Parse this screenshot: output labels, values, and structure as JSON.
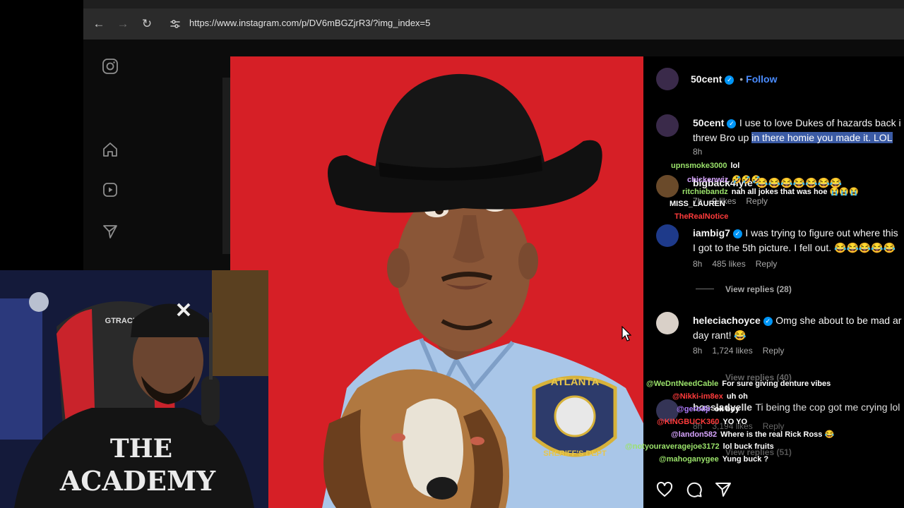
{
  "browser": {
    "url": "https://www.instagram.com/p/DV6mBGZjrR3/?img_index=5"
  },
  "post": {
    "author": "50cent",
    "follow_label": "Follow",
    "badge_lines": [
      "ATLANTA",
      "SHERIFF'S DEPT"
    ]
  },
  "comments": [
    {
      "user": "50cent",
      "text_line1": "I use to love Dukes of hazards back i",
      "text_line2_plain": "threw Bro up ",
      "text_line2_highlight": "in there homie you made it. LOL",
      "time": "8h"
    },
    {
      "user": "bigback4lyfe",
      "text": "😂😂😂😂😂😂😂",
      "time": "7h",
      "likes": "9 likes",
      "reply": "Reply"
    },
    {
      "user": "iambig7",
      "text_line1": "I was trying to figure out where this",
      "text_line2": "I got to the 5th picture. I fell out. 😂😂😂😂😂",
      "time": "8h",
      "likes": "485 likes",
      "reply": "Reply",
      "view_replies": "View replies (28)"
    },
    {
      "user": "heleciachoyce",
      "text_line1": "Omg she about to be mad ar",
      "text_line2": "day rant! 😂",
      "time": "8h",
      "likes": "1,724 likes",
      "reply": "Reply",
      "view_replies": "View replies (40)"
    },
    {
      "user": "bossladyelle",
      "text": "Ti being the cop got me crying lol",
      "time": "8h",
      "likes": "3,194 likes",
      "reply": "Reply",
      "view_replies": "View replies (51)"
    }
  ],
  "chat": [
    {
      "user": "upnsmoke3000",
      "msg": "lol",
      "color": "#9be36b"
    },
    {
      "user": "chickenwiz",
      "msg": "🤣🤣🤣",
      "color": "#d7a4ff"
    },
    {
      "user": "ritchiebandz",
      "msg": "nah all jokes that was hoe 😭😭😭",
      "color": "#9be36b"
    },
    {
      "user": "MISS_LAUREN",
      "msg": "",
      "color": "#ffffff"
    },
    {
      "user": "TheRealNotice",
      "msg": "",
      "color": "#ff3b3b"
    },
    {
      "user": "@WeDntNeedCable",
      "msg": "For sure giving denture vibes",
      "color": "#9be36b"
    },
    {
      "user": "@Nikki-im8ex",
      "msg": "uh oh",
      "color": "#ff3b3b"
    },
    {
      "user": "@gerodjr",
      "msg": "ok boy",
      "color": "#b07cff"
    },
    {
      "user": "@KINGBUCK360",
      "msg": "YO YO",
      "color": "#ff3b3b"
    },
    {
      "user": "@landon582",
      "msg": "Where is the real Rick Ross 😂",
      "color": "#d7a4ff"
    },
    {
      "user": "@notyouraveragejoe3172",
      "msg": "lol buck fruits",
      "color": "#9be36b"
    },
    {
      "user": "@mahoganygee",
      "msg": "Yung buck ?",
      "color": "#9be36b"
    }
  ],
  "webcam": {
    "shirt_text_line1": "THE",
    "shirt_text_line2": "ACADEMY",
    "chair_brand": "GTRACING"
  },
  "icons": [
    "back-icon",
    "forward-icon",
    "reload-icon",
    "site-settings-icon",
    "instagram-logo-icon",
    "home-icon",
    "reels-icon",
    "messages-icon",
    "heart-icon",
    "comment-icon",
    "share-icon",
    "verified-icon"
  ]
}
